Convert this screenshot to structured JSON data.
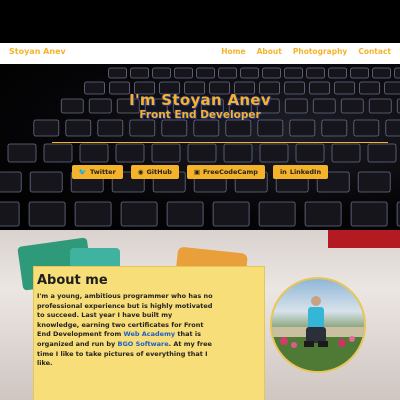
{
  "navbar": {
    "brand": "Stoyan Anev",
    "links": [
      "Home",
      "About",
      "Photography",
      "Contact"
    ]
  },
  "hero": {
    "title": "I'm Stoyan Anev",
    "subtitle": "Front End Developer",
    "social": [
      {
        "label": "Twitter",
        "icon": "twitter-icon"
      },
      {
        "label": "GitHub",
        "icon": "github-icon"
      },
      {
        "label": "FreeCodeCamp",
        "icon": "freecodecamp-icon"
      },
      {
        "label": "LinkedIn",
        "icon": "linkedin-icon"
      }
    ]
  },
  "about": {
    "heading": "About me",
    "text_before": "I'm a young, ambitious programmer who has no professional experience but is highly motivated to succeed. Last year I have built my knowledge, earning two certificates for Front End Development from ",
    "link1": "Web Academy",
    "text_middle": " that is organized and run by ",
    "link2": "BGO Software",
    "text_after": ". At my free time I like to take pictures of everything that I like."
  },
  "colors": {
    "accent": "#f5b32a",
    "card": "#f7de78",
    "link": "#1d5fc7"
  }
}
